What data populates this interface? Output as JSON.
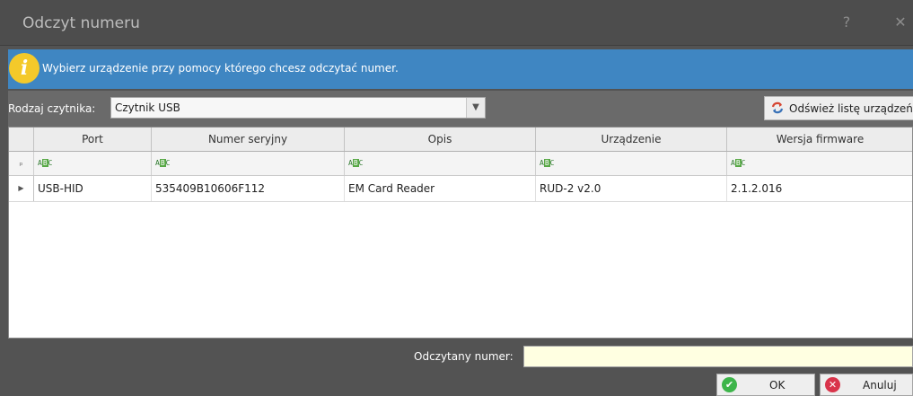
{
  "window": {
    "title": "Odczyt numeru",
    "help": "?",
    "close": "✕"
  },
  "info": {
    "icon": "i",
    "message": "Wybierz urządzenie przy pomocy którego chcesz odczytać numer."
  },
  "reader": {
    "label": "Rodzaj czytnika:",
    "selected": "Czytnik USB",
    "arrow": "▼"
  },
  "refresh": {
    "label": "Odśwież listę urządzeń"
  },
  "grid": {
    "columns": [
      "Port",
      "Numer seryjny",
      "Opis",
      "Urządzenie",
      "Wersja firmware"
    ],
    "filter_icon": "ABC",
    "pin": "ₚ",
    "row_marker": "▶",
    "rows": [
      [
        "USB-HID",
        "535409B10606F112",
        "EM Card Reader",
        "RUD-2 v2.0",
        "2.1.2.016"
      ]
    ]
  },
  "read_number": {
    "label": "Odczytany numer:",
    "value": ""
  },
  "buttons": {
    "ok": "OK",
    "cancel": "Anuluj"
  },
  "colors": {
    "info_bg": "#3f86c2",
    "window_bg": "#535353",
    "input_bg": "#ffffe1",
    "ok_icon": "#3db54a",
    "cancel_icon": "#d9344b"
  }
}
